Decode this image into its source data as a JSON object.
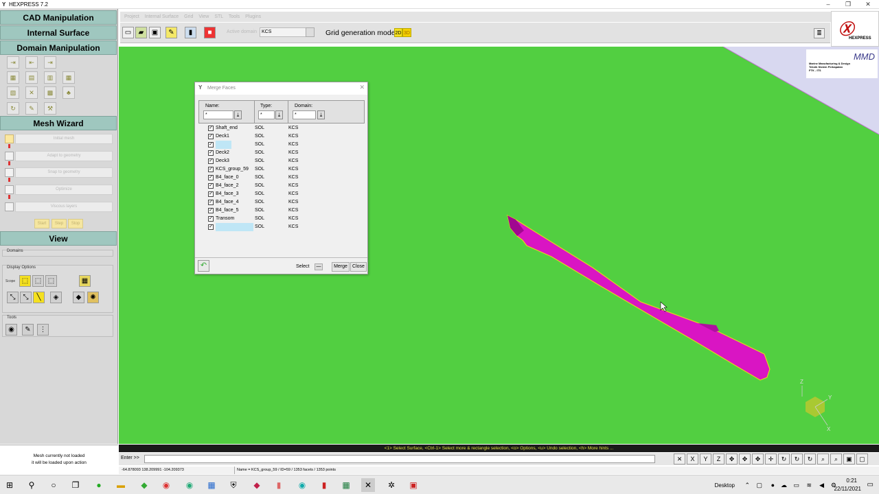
{
  "app": {
    "title": "HEXPRESS 7.2",
    "logo_glyph": "Y"
  },
  "window_controls": {
    "minimize": "–",
    "restore": "❐",
    "close": "✕"
  },
  "left_panel": {
    "sections": {
      "cad": "CAD Manipulation",
      "internal": "Internal Surface",
      "domain": "Domain Manipulation",
      "mesh_wizard": "Mesh Wizard",
      "view": "View"
    },
    "mesh_wizard_steps": [
      "Initial mesh",
      "Adapt to geometry",
      "Snap to geometry",
      "Optimize",
      "Viscous layers"
    ],
    "mesh_buttons": {
      "start": "Start",
      "step": "Step",
      "stop": "Stop"
    },
    "view_labels": {
      "domains": "Domains",
      "display_options": "Display Options",
      "scope": "Scope",
      "tools": "Tools"
    },
    "info": {
      "line1": "Mesh currently not loaded",
      "line2": "it will be loaded upon action"
    }
  },
  "menubar": [
    "Project",
    "Internal Surface",
    "Grid",
    "View",
    "STL",
    "Tools",
    "Plugins"
  ],
  "toolbar": {
    "active_domain_label": "Active domain",
    "active_domain_value": "KCS",
    "grid_mode_label": "Grid generation mode:",
    "mode_2d": "2D",
    "mode_3d": "3D"
  },
  "brand": {
    "mark": "Ⓧ",
    "name": "HEXPRESS"
  },
  "mmd_logo": {
    "title": "MMD",
    "line1": "Marine Manufacturing & Design",
    "line2": "Teknik Sistem Perkapalan",
    "line3": "FTK - ITS"
  },
  "dialog": {
    "title": "Merge Faces",
    "filters": {
      "name_label": "Name:",
      "name_value": "*",
      "type_label": "Type:",
      "type_value": "*",
      "domain_label": "Domain:",
      "domain_value": "*"
    },
    "rows": [
      {
        "name": "Shaft_end",
        "type": "SOL",
        "domain": "KCS",
        "selected": false
      },
      {
        "name": "Deck1",
        "type": "SOL",
        "domain": "KCS",
        "selected": false
      },
      {
        "name": "Rudder",
        "type": "SOL",
        "domain": "KCS",
        "selected": true
      },
      {
        "name": "Deck2",
        "type": "SOL",
        "domain": "KCS",
        "selected": false
      },
      {
        "name": "Deck3",
        "type": "SOL",
        "domain": "KCS",
        "selected": false
      },
      {
        "name": "KCS_group_59",
        "type": "SOL",
        "domain": "KCS",
        "selected": false
      },
      {
        "name": "B4_face_0",
        "type": "SOL",
        "domain": "KCS",
        "selected": false
      },
      {
        "name": "B4_face_2",
        "type": "SOL",
        "domain": "KCS",
        "selected": false
      },
      {
        "name": "B4_face_3",
        "type": "SOL",
        "domain": "KCS",
        "selected": false
      },
      {
        "name": "B4_face_4",
        "type": "SOL",
        "domain": "KCS",
        "selected": false
      },
      {
        "name": "B4_face_5",
        "type": "SOL",
        "domain": "KCS",
        "selected": false
      },
      {
        "name": "Transom",
        "type": "SOL",
        "domain": "KCS",
        "selected": false
      },
      {
        "name": "KCS_group_117",
        "type": "SOL",
        "domain": "KCS",
        "selected": true
      }
    ],
    "select_label": "Select",
    "merge_label": "Merge",
    "close_label": "Close"
  },
  "hint_bar": "<1> Select Surface, <Ctrl-1> Select more & rectangle selection, <o> Options, <u> Undo selection, <h> More hints ...",
  "command": {
    "label": "Enter >>"
  },
  "view_buttons": [
    "X",
    "Y",
    "Z"
  ],
  "coords": {
    "xyz": "-64.878093   138.209991   -104.209373",
    "status": "Name = KCS_group_59 / ID=59 / 1353 facets / 1353 points"
  },
  "axes": {
    "z": "Z",
    "y": "Y",
    "x": "X"
  },
  "taskbar": {
    "desktop": "Desktop",
    "time": "0:21",
    "date": "22/11/2021"
  },
  "colors": {
    "viewport": "#52cf41",
    "hull": "#d915c3",
    "panel_header": "#9fc7bf"
  }
}
